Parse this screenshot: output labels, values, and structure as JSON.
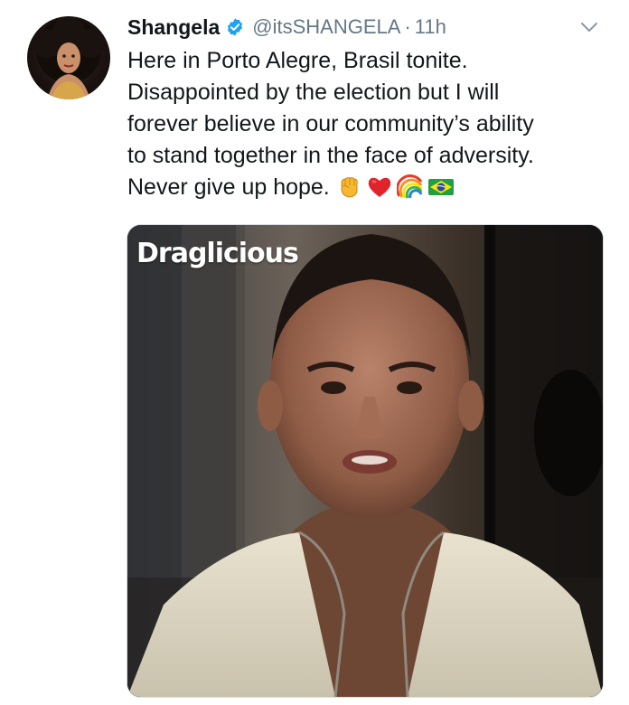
{
  "tweet": {
    "display_name": "Shangela",
    "handle": "@itsSHANGELA",
    "separator": "·",
    "time": "11h",
    "text_lines": [
      "Here in Porto Alegre, Brasil tonite.",
      "Disappointed by the election but I will",
      "forever believe in our community’s ability",
      "to stand together in the face of adversity.",
      "Never give up hope."
    ],
    "emojis": [
      "raised-fist-emoji",
      "red-heart-emoji",
      "rainbow-emoji",
      "brazil-flag-emoji"
    ],
    "media": {
      "watermark": "Draglicious"
    }
  },
  "colors": {
    "text": "#14171a",
    "muted": "#657786",
    "verified": "#1da1f2"
  }
}
